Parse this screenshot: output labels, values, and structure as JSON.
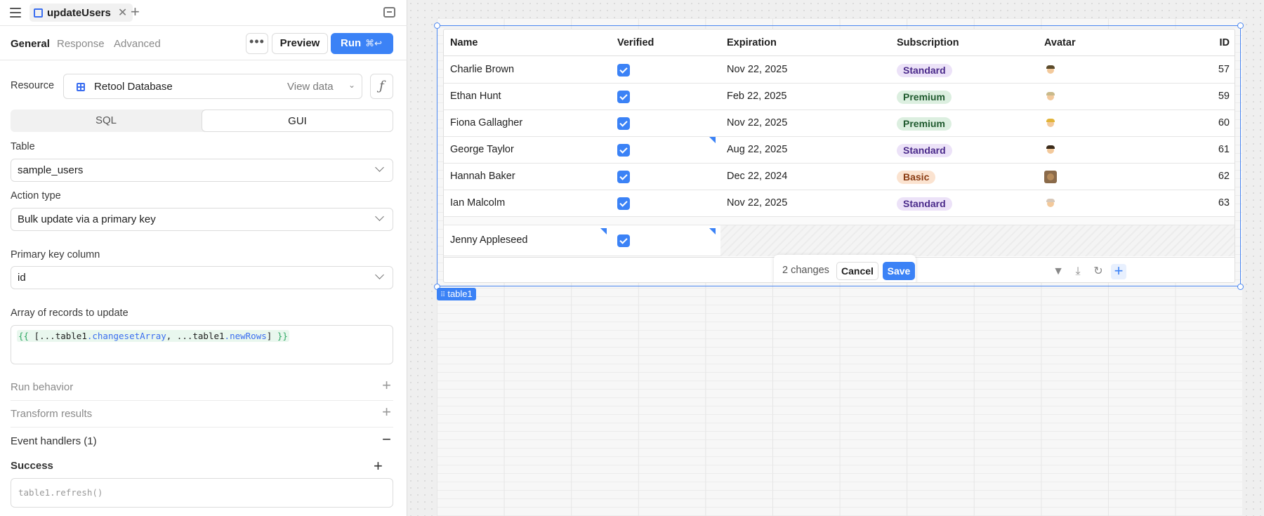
{
  "query_tab": {
    "name": "updateUsers"
  },
  "subtabs": [
    "General",
    "Response",
    "Advanced"
  ],
  "toolbar": {
    "more_label": "•••",
    "preview_label": "Preview",
    "run_label": "Run",
    "run_shortcut": "⌘↩"
  },
  "resource": {
    "label": "Resource",
    "name": "Retool Database",
    "view_data": "View data"
  },
  "mode": {
    "options": [
      "SQL",
      "GUI"
    ],
    "selected": "GUI"
  },
  "table_field": {
    "label": "Table",
    "value": "sample_users"
  },
  "action_type": {
    "label": "Action type",
    "value": "Bulk update via a primary key"
  },
  "primary_key": {
    "label": "Primary key column",
    "value": "id"
  },
  "records": {
    "label": "Array of records to update",
    "code": {
      "open": "{{",
      "p1": " [...table1",
      "prop1": ".changesetArray",
      "p2": ", ...table1",
      "prop2": ".newRows",
      "p3": "] ",
      "close": "}}"
    }
  },
  "sections": {
    "run_behavior": "Run behavior",
    "transform_results": "Transform results",
    "event_handlers": "Event handlers (1)",
    "success": "Success",
    "success_code": "table1.refresh()"
  },
  "grid": {
    "component_name": "table1",
    "columns": [
      "Name",
      "Verified",
      "Expiration",
      "Subscription",
      "Avatar",
      "ID"
    ],
    "rows": [
      {
        "name": "Charlie Brown",
        "expiration": "Nov 22, 2025",
        "subscription": "Standard",
        "id": "57"
      },
      {
        "name": "Ethan Hunt",
        "expiration": "Feb 22, 2025",
        "subscription": "Premium",
        "id": "59"
      },
      {
        "name": "Fiona Gallagher",
        "expiration": "Nov 22, 2025",
        "subscription": "Premium",
        "id": "60"
      },
      {
        "name": "George Taylor",
        "expiration": "Aug 22, 2025",
        "subscription": "Standard",
        "id": "61"
      },
      {
        "name": "Hannah Baker",
        "expiration": "Dec 22, 2024",
        "subscription": "Basic",
        "id": "62"
      },
      {
        "name": "Ian Malcolm",
        "expiration": "Nov 22, 2025",
        "subscription": "Standard",
        "id": "63"
      }
    ],
    "new_row": {
      "name": "Jenny Appleseed"
    },
    "changes_text": "2 changes",
    "cancel_label": "Cancel",
    "save_label": "Save"
  },
  "colors": {
    "accent": "#3b82f6",
    "standard": "#ece2f8",
    "premium": "#dcefe0",
    "basic": "#fbe3d0"
  }
}
